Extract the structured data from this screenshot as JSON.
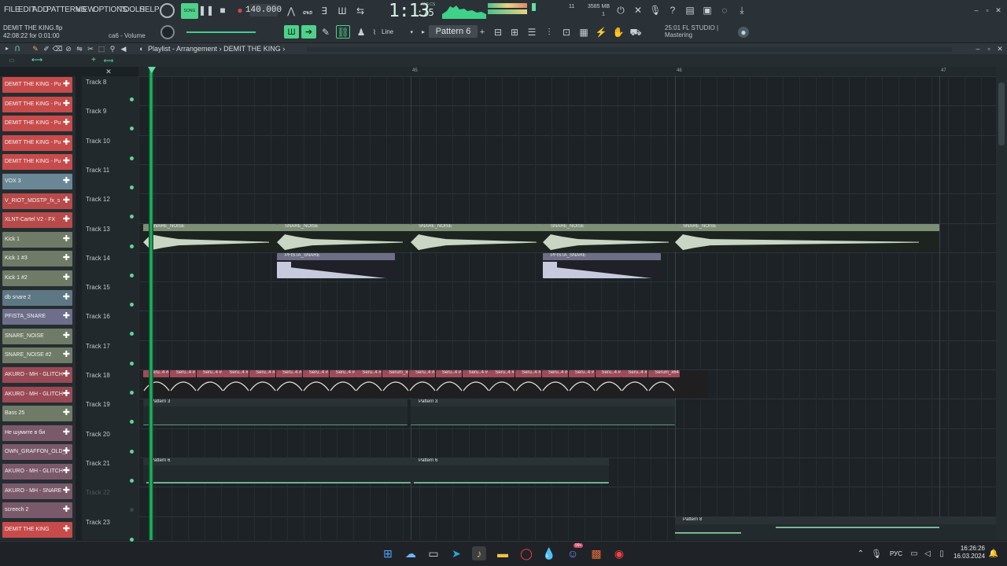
{
  "menu": {
    "file": "FILE",
    "edit": "EDIT",
    "add": "ADD",
    "patterns": "PATTERNS",
    "view": "VIEW",
    "options": "OPTIONS",
    "tools": "TOOLS",
    "help": "HELP"
  },
  "transport": {
    "song_mode": "SONG",
    "tempo": "140.000",
    "time_main": "1:13",
    "time_sub": ":75",
    "time_label": "M:S:CS",
    "cpu_mem": "3585 MB",
    "voices": "11",
    "poly": "1"
  },
  "file": {
    "name": "DEMIT THE KING.flp",
    "session": "42:08:22 for 0:01:00"
  },
  "hint": "са6 - Volume",
  "tool": {
    "snap": "Line",
    "pattern": "Pattern 6"
  },
  "flstudio": {
    "line1": "25:01 FL STUDIO |",
    "line2": "Mastering"
  },
  "playlist": {
    "title": "Playlist - Arrangement",
    "sep": "›",
    "project": "DEMIT THE KING",
    "arrow": "›"
  },
  "ruler": {
    "m1": "45",
    "m2": "46",
    "m3": "47"
  },
  "channels": [
    {
      "label": "DEMIT THE KING - Pu",
      "color": "#c84b4b"
    },
    {
      "label": "DEMIT THE KING - Pu",
      "color": "#c84b4b"
    },
    {
      "label": "DEMIT THE KING - Pu",
      "color": "#c84b4b"
    },
    {
      "label": "DEMIT THE KING - Pu",
      "color": "#c84b4b"
    },
    {
      "label": "DEMIT THE KING - Pu",
      "color": "#c84b4b"
    },
    {
      "label": "VOX 3",
      "color": "#6a8796"
    },
    {
      "label": "V_RIOT_MDSTP_fx_s",
      "color": "#b84a4a"
    },
    {
      "label": "XLNT-Cartel V2 - FX",
      "color": "#b84a4a"
    },
    {
      "label": "Kick 1",
      "color": "#6f7b66"
    },
    {
      "label": "Kick 1 #3",
      "color": "#6f7b66"
    },
    {
      "label": "Kick 1 #2",
      "color": "#6f7b66"
    },
    {
      "label": "db snare 2",
      "color": "#5e7784"
    },
    {
      "label": "PFISTA_SNARE",
      "color": "#6c6e8a"
    },
    {
      "label": "SNARE_NOISE",
      "color": "#6f7b66"
    },
    {
      "label": "SNARE_NOISE #2",
      "color": "#6f7b66"
    },
    {
      "label": "AKURO - MH - GLITCH",
      "color": "#9a4a55"
    },
    {
      "label": "AKURO - MH - GLITCH",
      "color": "#9a4a55"
    },
    {
      "label": "Bass 25",
      "color": "#6f7b66"
    },
    {
      "label": "Не шумите в би",
      "color": "#7a5a6a"
    },
    {
      "label": "OWN_GRAFFON_OLD_",
      "color": "#7a5a6a"
    },
    {
      "label": "AKURO - MH - GLITCH",
      "color": "#7a5a6a"
    },
    {
      "label": "AKURO - MH - SNARE",
      "color": "#7a5a6a"
    },
    {
      "label": "screech 2",
      "color": "#7a5a6a"
    },
    {
      "label": "DEMIT THE KING",
      "color": "#c84b4b"
    }
  ],
  "tracks": [
    "Track 8",
    "Track 9",
    "Track 10",
    "Track 11",
    "Track 12",
    "Track 13",
    "Track 14",
    "Track 15",
    "Track 16",
    "Track 17",
    "Track 18",
    "Track 19",
    "Track 20",
    "Track 21",
    "Track 22",
    "Track 23"
  ],
  "clips": {
    "snare_noise": "SNARE_NOISE",
    "pfista": "PFISTA_SNARE",
    "seru": "Seru..4 #7",
    "serum_x6": "Serum_x6",
    "serum_x64": "Serum_x64 #7",
    "pattern3": "Pattern 3",
    "pattern6": "Pattern 6",
    "pattern8": "Pattern 8"
  },
  "taskbar": {
    "time": "16:26:26",
    "date": "16.03.2024",
    "lang": "РУС",
    "badge": "99+"
  }
}
